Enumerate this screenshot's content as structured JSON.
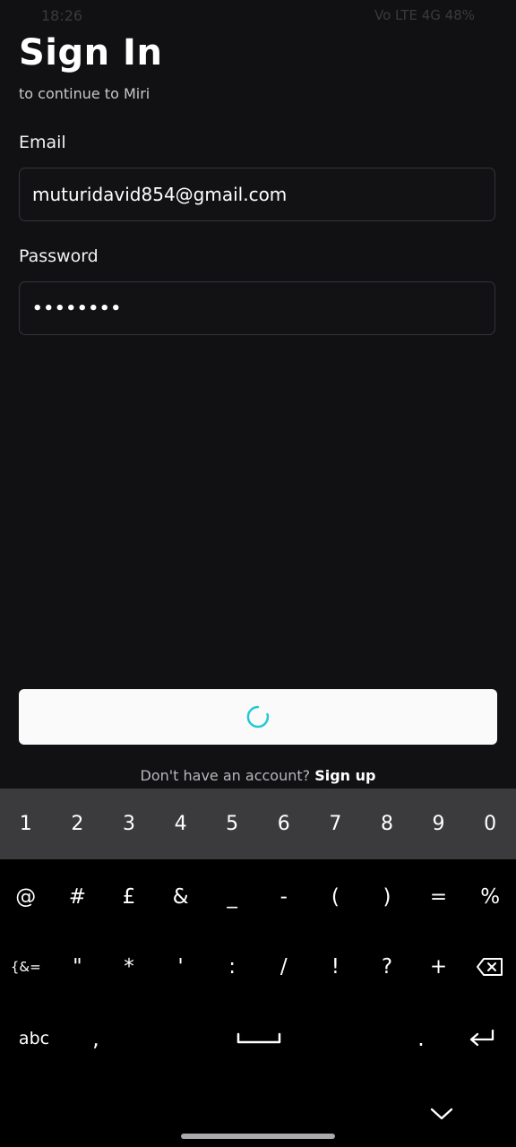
{
  "status": {
    "time": "18:26",
    "right": "Vo LTE 4G 48%"
  },
  "title": "Sign In",
  "subtitle": "to continue to Miri",
  "email": {
    "label": "Email",
    "value": "muturidavid854@gmail.com"
  },
  "password": {
    "label": "Password",
    "value": "••••••••"
  },
  "submit": {
    "state": "loading",
    "spinner_color": "#22c9d4"
  },
  "signup": {
    "prompt": "Don't have an account?",
    "link": "Sign up"
  },
  "keyboard": {
    "numbers": [
      "1",
      "2",
      "3",
      "4",
      "5",
      "6",
      "7",
      "8",
      "9",
      "0"
    ],
    "symbols_row_1": [
      "@",
      "#",
      "£",
      "&",
      "_",
      "-",
      "(",
      ")",
      "=",
      "%"
    ],
    "symbols_row_2": [
      "{&=",
      "\"",
      "*",
      "'",
      ":",
      "/",
      "!",
      "?",
      "+"
    ],
    "bottom_row": {
      "abc": "abc",
      "comma": ",",
      "period": "."
    }
  }
}
